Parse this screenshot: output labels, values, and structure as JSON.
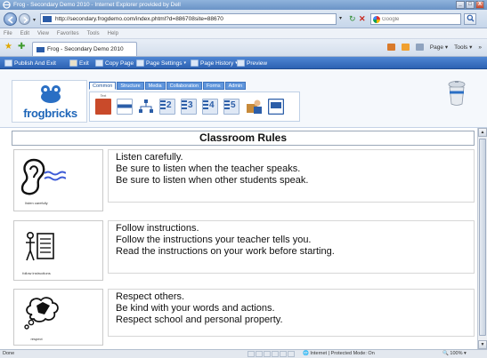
{
  "window": {
    "title": "Frog - Secondary Demo 2010 - Internet Explorer provided by Dell",
    "minimize": "_",
    "maximize": "□",
    "close": "X"
  },
  "address": {
    "url": "http://secondary.frogdemo.com/index.phtml?d=886708site=88670",
    "search_placeholder": "Google"
  },
  "menu": [
    "File",
    "Edit",
    "View",
    "Favorites",
    "Tools",
    "Help"
  ],
  "tab": {
    "label": "Frog - Secondary Demo 2010"
  },
  "commands": {
    "page": "Page",
    "tools": "Tools",
    "chevron": "»"
  },
  "frog_toolbar": {
    "publish": "Publish And Exit",
    "exit": "Exit",
    "copy_page": "Copy Page",
    "page_settings": "Page Settings",
    "page_history": "Page History",
    "preview": "Preview"
  },
  "editor": {
    "logo": "frogbricks",
    "tabs": [
      "Common",
      "Structure",
      "Media",
      "Collaboration",
      "Forms",
      "Admin"
    ],
    "widgets": [
      {
        "label": "Text",
        "num": ""
      },
      {
        "label": "",
        "num": ""
      },
      {
        "label": "",
        "num": ""
      },
      {
        "label": "",
        "num": "2"
      },
      {
        "label": "",
        "num": "3"
      },
      {
        "label": "",
        "num": "4"
      },
      {
        "label": "",
        "num": "5"
      },
      {
        "label": "",
        "num": ""
      },
      {
        "label": "",
        "num": ""
      }
    ]
  },
  "page": {
    "title": "Classroom Rules",
    "rules": [
      {
        "caption": "listen carefully",
        "lines": [
          "Listen carefully.",
          "Be sure to listen when the teacher speaks.",
          "Be sure to listen when other students speak."
        ]
      },
      {
        "caption": "follow instructions",
        "lines": [
          "Follow instructions.",
          "Follow the instructions your teacher tells you.",
          "Read the instructions on your work before starting."
        ]
      },
      {
        "caption": "respect",
        "lines": [
          "Respect others.",
          "Be kind with your words and actions.",
          "Respect school and personal property."
        ]
      }
    ]
  },
  "status": {
    "left": "Done",
    "zone": "Internet | Protected Mode: On",
    "zoom": "100%"
  }
}
